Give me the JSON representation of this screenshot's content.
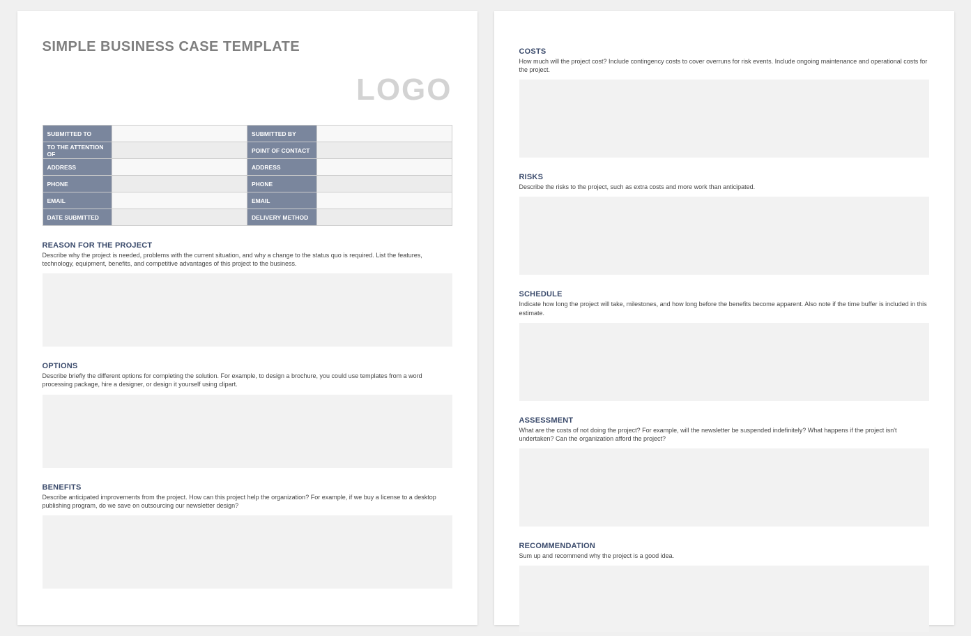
{
  "title": "SIMPLE BUSINESS CASE TEMPLATE",
  "logo": "LOGO",
  "info": {
    "r0c0": "SUBMITTED TO",
    "r0c1": "SUBMITTED BY",
    "r1c0": "TO THE ATTENTION OF",
    "r1c1": "POINT OF CONTACT",
    "r2c0": "ADDRESS",
    "r2c1": "ADDRESS",
    "r3c0": "PHONE",
    "r3c1": "PHONE",
    "r4c0": "EMAIL",
    "r4c1": "EMAIL",
    "r5c0": "DATE SUBMITTED",
    "r5c1": "DELIVERY METHOD"
  },
  "sections": {
    "reason": {
      "title": "REASON FOR THE PROJECT",
      "desc": "Describe why the project is needed, problems with the current situation, and why a change to the status quo is required. List the features, technology, equipment, benefits, and competitive advantages of this project to the business."
    },
    "options": {
      "title": "OPTIONS",
      "desc": "Describe briefly the different options for completing the solution. For example, to design a brochure, you could use templates from a word processing package, hire a designer, or design it yourself using clipart."
    },
    "benefits": {
      "title": "BENEFITS",
      "desc": "Describe anticipated improvements from the project. How can this project help the organization? For example, if we buy a license to a desktop publishing program, do we save on outsourcing our newsletter design?"
    },
    "costs": {
      "title": "COSTS",
      "desc": "How much will the project cost? Include contingency costs to cover overruns for risk events. Include ongoing maintenance and operational costs for the project."
    },
    "risks": {
      "title": "RISKS",
      "desc": "Describe the risks to the project, such as extra costs and more work than anticipated."
    },
    "schedule": {
      "title": "SCHEDULE",
      "desc": "Indicate how long the project will take, milestones, and how long before the benefits become apparent. Also note if the time buffer is included in this estimate."
    },
    "assessment": {
      "title": "ASSESSMENT",
      "desc": "What are the costs of not doing the project? For example, will the newsletter be suspended indefinitely? What happens if the project isn't undertaken? Can the organization afford the project?"
    },
    "recommendation": {
      "title": "RECOMMENDATION",
      "desc": "Sum up and recommend why the project is a good idea."
    }
  }
}
